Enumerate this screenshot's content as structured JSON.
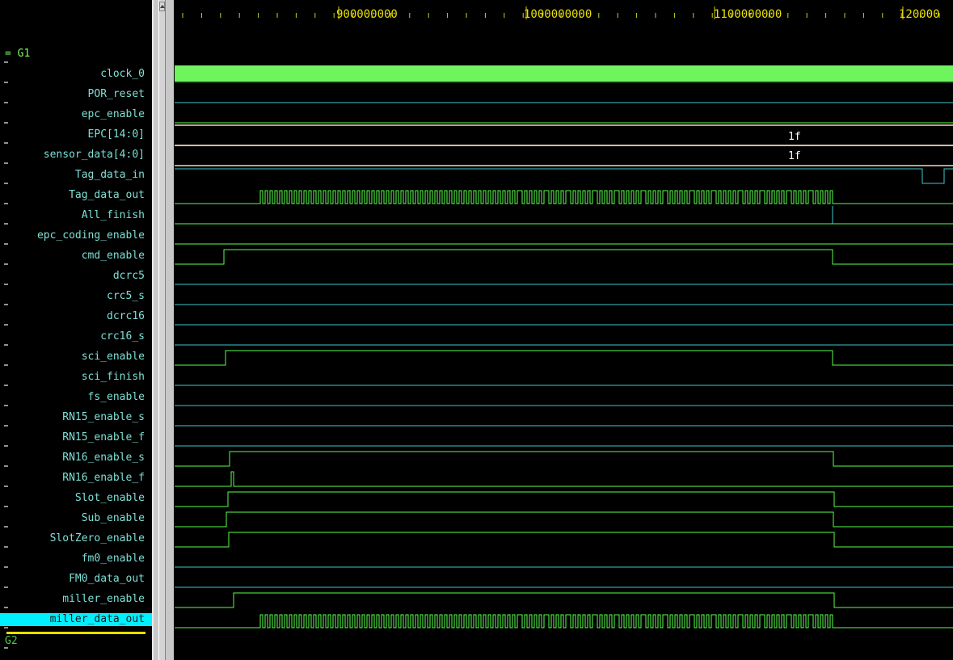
{
  "ruler": {
    "labels": [
      "900000000",
      "1000000000",
      "1100000000",
      "120000"
    ]
  },
  "groups": {
    "g1": "= G1",
    "g2": "G2"
  },
  "signals": [
    {
      "name": "clock_0"
    },
    {
      "name": "POR_reset"
    },
    {
      "name": "epc_enable"
    },
    {
      "name": "EPC[14:0]",
      "value": "1f"
    },
    {
      "name": "sensor_data[4:0]",
      "value": "1f"
    },
    {
      "name": "Tag_data_in"
    },
    {
      "name": "Tag_data_out"
    },
    {
      "name": "All_finish"
    },
    {
      "name": "epc_coding_enable"
    },
    {
      "name": "cmd_enable"
    },
    {
      "name": "dcrc5"
    },
    {
      "name": "crc5_s"
    },
    {
      "name": "dcrc16"
    },
    {
      "name": "crc16_s"
    },
    {
      "name": "sci_enable"
    },
    {
      "name": "sci_finish"
    },
    {
      "name": "fs_enable"
    },
    {
      "name": "RN15_enable_s"
    },
    {
      "name": "RN15_enable_f"
    },
    {
      "name": "RN16_enable_s"
    },
    {
      "name": "RN16_enable_f"
    },
    {
      "name": "Slot_enable"
    },
    {
      "name": "Sub_enable"
    },
    {
      "name": "SlotZero_enable"
    },
    {
      "name": "fm0_enable"
    },
    {
      "name": "FM0_data_out"
    },
    {
      "name": "miller_enable"
    },
    {
      "name": "miller_data_out",
      "selected": true
    }
  ],
  "colors": {
    "wave_green": "#58ff4a",
    "wave_cyan": "#3cc8d0",
    "clock_fill": "#6ef55e",
    "bus_line": "#f0d8c0",
    "name_text": "#7ee0d6",
    "ruler_text": "#e8e000",
    "selected_bg": "#00f0ff"
  }
}
